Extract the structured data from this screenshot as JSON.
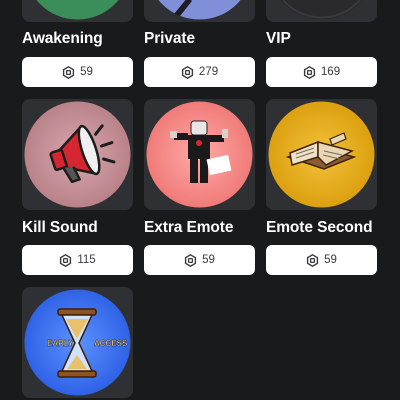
{
  "colors": {
    "background": "#191a1c",
    "card_bg": "#2e3033",
    "price_bg": "#ffffff",
    "price_text": "#393b3d"
  },
  "items": [
    {
      "name": "Awakening",
      "price": "59",
      "icon": "green-badge-icon"
    },
    {
      "name": "Private",
      "price": "279",
      "icon": "private-server-badge-icon"
    },
    {
      "name": "VIP",
      "price": "169",
      "icon": "vip-badge-icon"
    },
    {
      "name": "Kill Sound",
      "price": "115",
      "icon": "megaphone-icon"
    },
    {
      "name": "Extra Emote",
      "price": "59",
      "icon": "emote-character-icon"
    },
    {
      "name": "Emote Second",
      "price": "59",
      "icon": "open-book-icon"
    },
    {
      "name": "",
      "price": "",
      "icon": "early-access-hourglass-icon",
      "badge_text": [
        "EARLY",
        "ACCESS"
      ]
    }
  ]
}
